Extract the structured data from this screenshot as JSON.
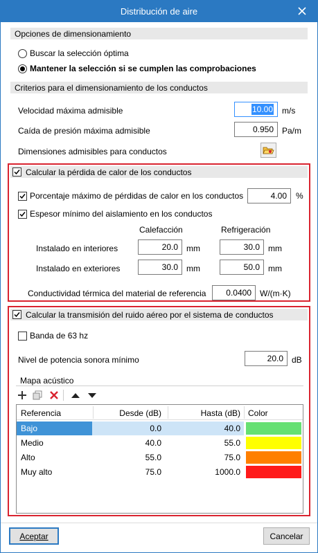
{
  "window": {
    "title": "Distribución de aire"
  },
  "sizing_options": {
    "header": "Opciones de dimensionamiento",
    "option_optimal": "Buscar la selección óptima",
    "option_keep": "Mantener la selección si se cumplen las comprobaciones",
    "selected": "option_keep"
  },
  "duct_criteria": {
    "header": "Criterios para el dimensionamiento de los conductos",
    "max_velocity_label": "Velocidad máxima admisible",
    "max_velocity_value": "10.00",
    "max_velocity_unit": "m/s",
    "max_pressure_drop_label": "Caída de presión máxima admisible",
    "max_pressure_drop_value": "0.950",
    "max_pressure_drop_unit": "Pa/m",
    "admissible_dims_label": "Dimensiones admisibles para conductos"
  },
  "heat_loss": {
    "header": "Calcular la pérdida de calor de los conductos",
    "enabled": true,
    "max_pct_label": "Porcentaje máximo de pérdidas de calor en los conductos",
    "max_pct_value": "4.00",
    "max_pct_unit": "%",
    "min_insulation_label": "Espesor mínimo del aislamiento en los conductos",
    "col_heating": "Calefacción",
    "col_cooling": "Refrigeración",
    "row_interior_label": "Instalado en interiores",
    "row_interior_heating": "20.0",
    "row_interior_cooling": "30.0",
    "row_exterior_label": "Instalado en exteriores",
    "row_exterior_heating": "30.0",
    "row_exterior_cooling": "50.0",
    "unit_mm": "mm",
    "conductivity_label": "Conductividad térmica del material de referencia",
    "conductivity_value": "0.0400",
    "conductivity_unit": "W/(m·K)"
  },
  "noise": {
    "header": "Calcular la transmisión del ruido aéreo por el sistema de conductos",
    "enabled": true,
    "band_63_label": "Banda de 63 hz",
    "band_63_checked": false,
    "min_power_label": "Nivel de potencia sonora mínimo",
    "min_power_value": "20.0",
    "min_power_unit": "dB",
    "acoustic_map_label": "Mapa acústico",
    "toolbar_icons": [
      "add-icon",
      "copy-icon",
      "delete-icon",
      "move-up-icon",
      "move-down-icon"
    ],
    "table_headers": {
      "ref": "Referencia",
      "from": "Desde (dB)",
      "to": "Hasta (dB)",
      "color": "Color"
    },
    "rows": [
      {
        "ref": "Bajo",
        "from": "0.0",
        "to": "40.0",
        "color": "#66e073"
      },
      {
        "ref": "Medio",
        "from": "40.0",
        "to": "55.0",
        "color": "#ffff00"
      },
      {
        "ref": "Alto",
        "from": "55.0",
        "to": "75.0",
        "color": "#ff7f00"
      },
      {
        "ref": "Muy alto",
        "from": "75.0",
        "to": "1000.0",
        "color": "#ff1a1a"
      }
    ],
    "selected_row": 0
  },
  "footer": {
    "accept": "Aceptar",
    "cancel": "Cancelar"
  },
  "colors": {
    "titlebar": "#2b79c2",
    "highlight_border": "#d9232f",
    "selection": "#3390ff"
  }
}
